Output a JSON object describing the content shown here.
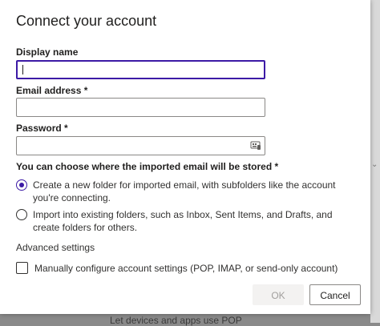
{
  "dialog": {
    "title": "Connect your account",
    "display_name": {
      "label": "Display name",
      "value": ""
    },
    "email": {
      "label": "Email address *",
      "value": ""
    },
    "password": {
      "label": "Password *",
      "value": "",
      "reveal_icon": "reveal-password-icon"
    },
    "storage": {
      "question": "You can choose where the imported email will be stored *",
      "options": [
        {
          "label": "Create a new folder for imported email, with subfolders like the account you're connecting.",
          "selected": true
        },
        {
          "label": "Import into existing folders, such as Inbox, Sent Items, and Drafts, and create folders for others.",
          "selected": false
        }
      ]
    },
    "advanced": {
      "heading": "Advanced settings",
      "manual_config": {
        "label": "Manually configure account settings (POP, IMAP, or send-only account)",
        "checked": false
      }
    },
    "buttons": {
      "ok": "OK",
      "cancel": "Cancel"
    }
  },
  "background": {
    "partial_text": "Let devices and apps use POP"
  },
  "colors": {
    "accent": "#3c1aa6",
    "disabled_text": "#a19f9d"
  }
}
